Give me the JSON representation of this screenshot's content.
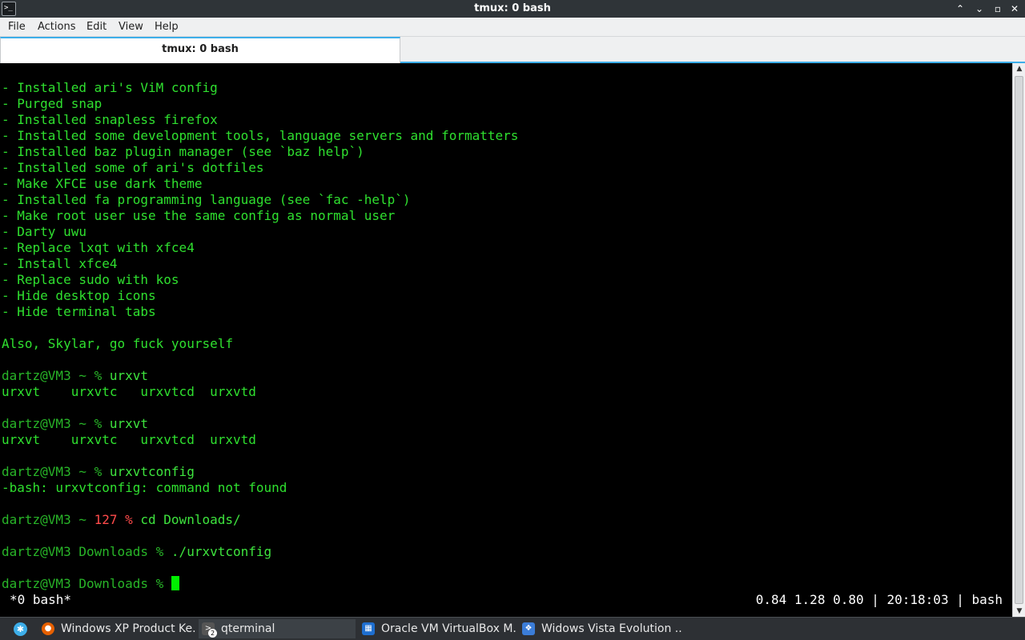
{
  "window": {
    "title": "tmux: 0 bash",
    "app_icon": "terminal-icon",
    "buttons": [
      "minimize-icon",
      "restore-icon",
      "maximize-icon",
      "close-icon"
    ]
  },
  "menubar": {
    "items": [
      "File",
      "Actions",
      "Edit",
      "View",
      "Help"
    ]
  },
  "tabs": [
    {
      "label": "tmux: 0 bash"
    }
  ],
  "terminal": {
    "lines": [
      {
        "text": "- Installed ari's ViM config"
      },
      {
        "text": "- Purged snap"
      },
      {
        "text": "- Installed snapless firefox"
      },
      {
        "text": "- Installed some development tools, language servers and formatters"
      },
      {
        "text": "- Installed baz plugin manager (see `baz help`)"
      },
      {
        "text": "- Installed some of ari's dotfiles"
      },
      {
        "text": "- Make XFCE use dark theme"
      },
      {
        "text": "- Installed fa programming language (see `fac -help`)"
      },
      {
        "text": "- Make root user use the same config as normal user"
      },
      {
        "text": "- Darty uwu"
      },
      {
        "text": "- Replace lxqt with xfce4"
      },
      {
        "text": "- Install xfce4"
      },
      {
        "text": "- Replace sudo with kos"
      },
      {
        "text": "- Hide desktop icons"
      },
      {
        "text": "- Hide terminal tabs"
      },
      {
        "text": ""
      },
      {
        "text": "Also, Skylar, go fuck yourself"
      },
      {
        "text": ""
      },
      {
        "prompt": "dartz@VM3 ~ % ",
        "cmd": "urxvt"
      },
      {
        "text": "urxvt    urxvtc   urxvtcd  urxvtd"
      },
      {
        "text": ""
      },
      {
        "prompt": "dartz@VM3 ~ % ",
        "cmd": "urxvt"
      },
      {
        "text": "urxvt    urxvtc   urxvtcd  urxvtd"
      },
      {
        "text": ""
      },
      {
        "prompt": "dartz@VM3 ~ % ",
        "cmd": "urxvtconfig"
      },
      {
        "text": "-bash: urxvtconfig: command not found"
      },
      {
        "text": ""
      },
      {
        "prompt": "dartz@VM3 ~ ",
        "err": "127 % ",
        "cmd": "cd Downloads/"
      },
      {
        "text": ""
      },
      {
        "prompt": "dartz@VM3 Downloads % ",
        "cmd": "./urxvtconfig"
      },
      {
        "text": ""
      },
      {
        "prompt": "dartz@VM3 Downloads % ",
        "cmd": "",
        "cursor": true
      }
    ],
    "status_left": "*0 bash*",
    "status_right": "0.84 1.28 0.80 | 20:18:03 | bash"
  },
  "taskbar": {
    "start_icon": "kde-launcher-icon",
    "tasks": [
      {
        "label": "Windows XP Product Ke...",
        "icon": "firefox-icon",
        "icon_color": "#e66000"
      },
      {
        "label": "qterminal",
        "icon": "terminal-icon",
        "icon_color": "#555555",
        "badge": "2"
      },
      {
        "label": "Oracle VM VirtualBox M...",
        "icon": "virtualbox-icon",
        "icon_color": "#1e6fd0"
      },
      {
        "label": "Widows Vista Evolution ...",
        "icon": "vista-window-icon",
        "icon_color": "#3b7dd8"
      }
    ]
  },
  "colors": {
    "terminal_text": "#2fe02f",
    "prompt": "#28b528",
    "error": "#ff4b4b",
    "accent": "#3daee9"
  }
}
